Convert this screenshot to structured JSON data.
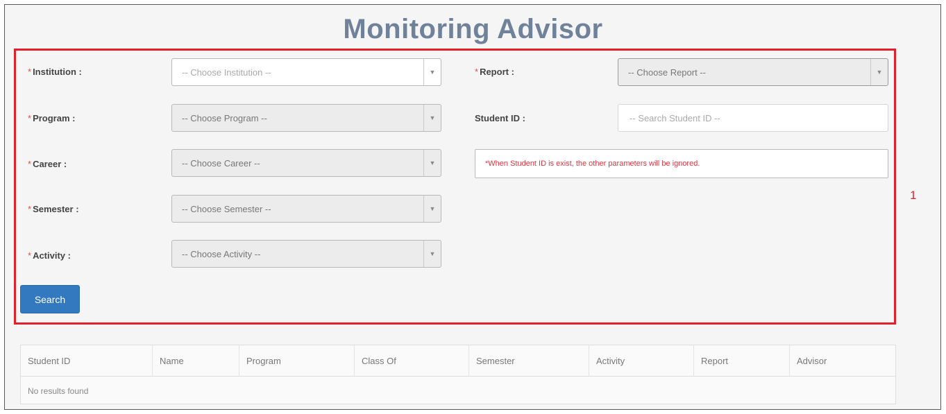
{
  "page": {
    "title": "Monitoring Advisor",
    "callout_number": "1"
  },
  "form": {
    "required_mark": "*",
    "institution": {
      "label": "Institution :",
      "placeholder": "-- Choose Institution --"
    },
    "program": {
      "label": "Program :",
      "placeholder": "-- Choose Program --"
    },
    "career": {
      "label": "Career :",
      "placeholder": "-- Choose Career --"
    },
    "semester": {
      "label": "Semester :",
      "placeholder": "-- Choose Semester --"
    },
    "activity": {
      "label": "Activity :",
      "placeholder": "-- Choose Activity --"
    },
    "report": {
      "label": "Report :",
      "placeholder": "-- Choose Report --"
    },
    "student_id": {
      "label": "Student ID :",
      "placeholder": "-- Search Student ID --"
    },
    "notice": "*When Student ID is exist, the other parameters will be ignored.",
    "search_label": "Search"
  },
  "table": {
    "columns": [
      "Student ID",
      "Name",
      "Program",
      "Class Of",
      "Semester",
      "Activity",
      "Report",
      "Advisor"
    ],
    "empty_text": "No results found"
  },
  "colors": {
    "title": "#6f8299",
    "highlight": "#e2202c",
    "primary_button": "#3379bf",
    "notice_text": "#e0323e"
  },
  "icons": {
    "dropdown": "chevron-down-icon"
  }
}
